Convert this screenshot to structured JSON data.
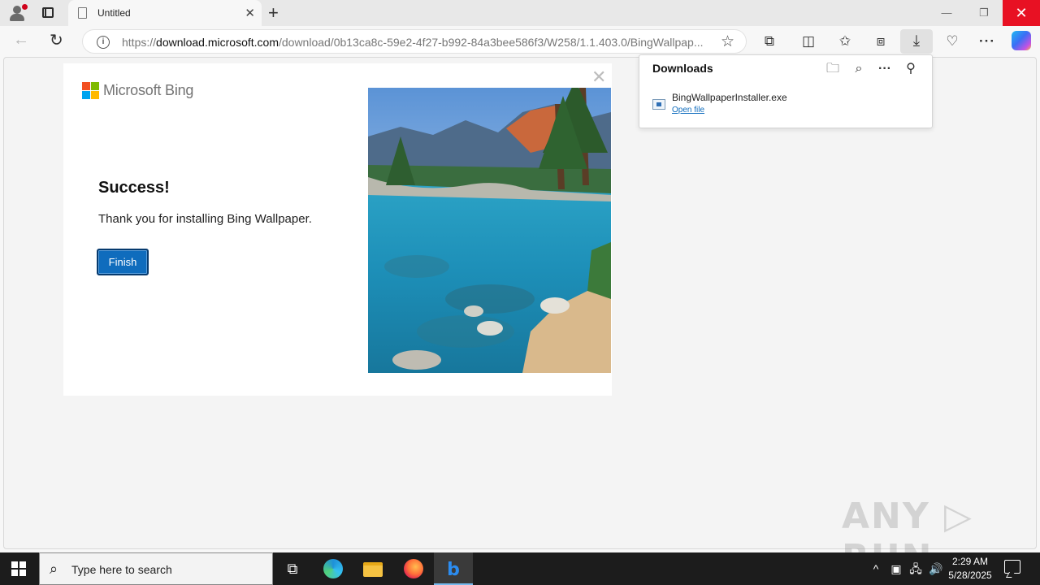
{
  "browser": {
    "tab_title": "Untitled",
    "tab_close": "✕",
    "new_tab": "+",
    "window_controls": {
      "minimize": "—",
      "restore": "❐",
      "close": "✕"
    },
    "url_prefix": "https://",
    "url_domain": "download.microsoft.com",
    "url_path": "/download/0b13ca8c-59e2-4f27-b992-84a3bee586f3/W258/1.1.403.0/BingWallpap...",
    "nav": {
      "back": "←",
      "refresh": "↻"
    },
    "address_icons": {
      "info": "i",
      "favorite": "☆"
    },
    "toolbar_icons": [
      "extensions-icon",
      "split-screen-icon",
      "favorites-icon",
      "collections-icon",
      "downloads-icon",
      "browser-essentials-icon",
      "more-icon",
      "copilot-icon"
    ],
    "toolbar_glyphs": {
      "extensions": "⧉",
      "split": "◫",
      "favorites": "✩",
      "collections": "⧈",
      "downloads": "⤓",
      "essentials": "♡",
      "more": "···"
    }
  },
  "installer": {
    "brand": "Microsoft Bing",
    "heading": "Success!",
    "message": "Thank you for installing Bing Wallpaper.",
    "finish_label": "Finish",
    "close_glyph": "✕"
  },
  "downloads": {
    "title": "Downloads",
    "icons": {
      "folder": "🗀",
      "search": "⌕",
      "more": "···",
      "pin": "⚲"
    },
    "items": [
      {
        "filename": "BingWallpaperInstaller.exe",
        "action": "Open file"
      }
    ]
  },
  "watermark": "ANY ▷ RUN",
  "taskbar": {
    "search_placeholder": "Type here to search",
    "search_glyph": "⌕",
    "taskview_glyph": "⧉",
    "tray": {
      "chevron": "^",
      "meet": "▣",
      "network": "🖧",
      "volume": "🔊"
    },
    "time": "2:29 AM",
    "date": "5/28/2025"
  },
  "colors": {
    "accent": "#0f6cbd",
    "close_red": "#e81123",
    "taskbar": "#1c1c1c"
  }
}
